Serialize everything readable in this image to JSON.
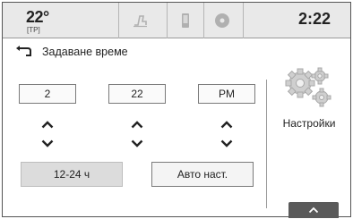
{
  "status": {
    "temperature": "22°",
    "temperature_sub": "[TP]",
    "time": "2:22",
    "icons": [
      "phone-handset-icon",
      "phone-device-icon",
      "record-icon"
    ]
  },
  "header": {
    "title": "Задаване време"
  },
  "time_setting": {
    "hour": "2",
    "minute": "22",
    "period": "PM"
  },
  "buttons": {
    "format_label": "12-24 ч",
    "auto_label": "Авто наст."
  },
  "settings": {
    "label": "Настройки"
  },
  "colors": {
    "statusbar": "#e9e9e9",
    "border": "#7a7a7a",
    "tray_button": "#5a5a5a"
  }
}
